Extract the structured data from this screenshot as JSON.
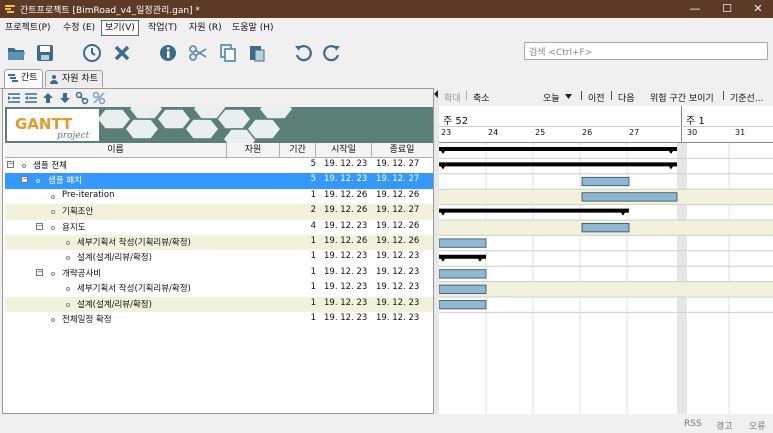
{
  "window": {
    "title": "간트프로젝트 [BimRoad_v4_일정관리.gan] *",
    "minimize": "—",
    "maximize": "☐",
    "close": "✕"
  },
  "menu": [
    {
      "label": "프로젝트(P)"
    },
    {
      "label": "수정 (E)"
    },
    {
      "label": "보기(V)"
    },
    {
      "label": "작업(T)"
    },
    {
      "label": "자원 (R)"
    },
    {
      "label": "도움말 (H)"
    }
  ],
  "search": {
    "placeholder": "검색 <Ctrl+F>"
  },
  "tabs": [
    {
      "label": "간트"
    },
    {
      "label": "자원 차트"
    }
  ],
  "banner": {
    "logo": "GANTT",
    "logo_sub": "project"
  },
  "columns": {
    "name": "이름",
    "resource": "자원",
    "duration": "기간",
    "start": "시작일",
    "end": "종료일"
  },
  "tasks": [
    {
      "name": "샘플 전체",
      "duration": "5",
      "start": "19. 12. 23",
      "end": "19. 12. 27"
    },
    {
      "name": "샘플 패치",
      "duration": "5",
      "start": "19. 12. 23",
      "end": "19. 12. 27"
    },
    {
      "name": "Pre-iteration",
      "duration": "1",
      "start": "19. 12. 26",
      "end": "19. 12. 26"
    },
    {
      "name": "기획조안",
      "duration": "2",
      "start": "19. 12. 26",
      "end": "19. 12. 27"
    },
    {
      "name": "용지도",
      "duration": "4",
      "start": "19. 12. 23",
      "end": "19. 12. 26"
    },
    {
      "name": "세부기획서 작성(기획리뷰/확정)",
      "duration": "1",
      "start": "19. 12. 26",
      "end": "19. 12. 26"
    },
    {
      "name": "설계(설계/리뷰/확정)",
      "duration": "1",
      "start": "19. 12. 23",
      "end": "19. 12. 23"
    },
    {
      "name": "개략공사비",
      "duration": "1",
      "start": "19. 12. 23",
      "end": "19. 12. 23"
    },
    {
      "name": "세부기획서 작성(기획리뷰/확정)",
      "duration": "1",
      "start": "19. 12. 23",
      "end": "19. 12. 23"
    },
    {
      "name": "설계(설계/리뷰/확정)",
      "duration": "1",
      "start": "19. 12. 23",
      "end": "19. 12. 23"
    },
    {
      "name": "전체일정 확정",
      "duration": "1",
      "start": "19. 12. 23",
      "end": "19. 12. 23"
    }
  ],
  "timeline_tools": {
    "zoom_in": "확대",
    "zoom_out": "축소",
    "today": "오늘",
    "prev": "이전",
    "next": "다음",
    "critical_path": "위험 구간 보이기",
    "baseline": "기준선..."
  },
  "timeline": {
    "weeks": [
      {
        "label": "주 52"
      },
      {
        "label": "주 1"
      }
    ],
    "days": [
      "23",
      "24",
      "25",
      "26",
      "27",
      "30",
      "31"
    ]
  },
  "status": {
    "rss": "RSS",
    "warnings": "경고",
    "errors": "오류"
  },
  "colors": {
    "titlebar": "#5c3a26",
    "selection": "#3399ff",
    "task_bar": "#8fb8d2",
    "alt_row": "#f1f1dc",
    "banner": "#5a7f77"
  }
}
